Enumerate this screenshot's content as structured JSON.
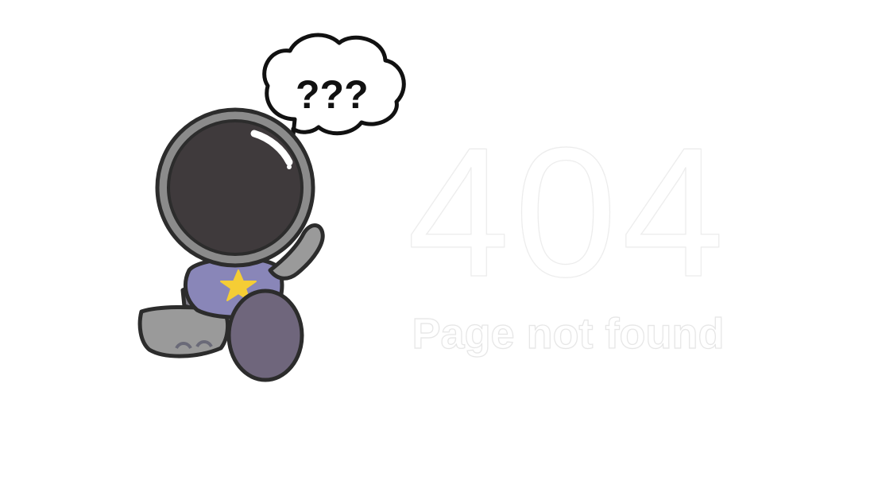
{
  "illustration": {
    "bubble_text": "???",
    "icon": "astronaut-illustration",
    "colors": {
      "helmet_visor": "#3f3a3c",
      "helmet_ring": "#8b8b8b",
      "outline": "#2c2c2c",
      "suit": "#8986b8",
      "star": "#f5cd35",
      "boot": "#6f667c",
      "leg": "#9a9a9a"
    }
  },
  "error": {
    "code": "404",
    "message": "Page not found"
  }
}
